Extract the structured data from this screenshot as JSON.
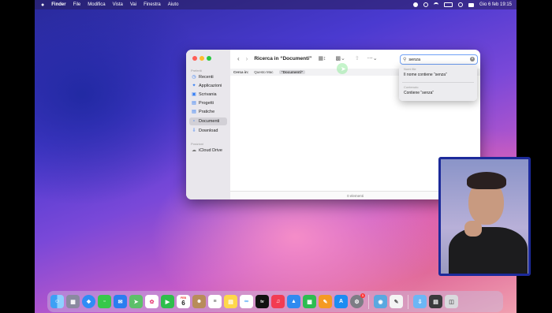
{
  "menubar": {
    "apple_icon": "apple-logo-icon",
    "items": [
      "Finder",
      "File",
      "Modifica",
      "Vista",
      "Vai",
      "Finestra",
      "Aiuto"
    ],
    "datetime": "Gio 6 feb  19:15"
  },
  "finder": {
    "title": "Ricerca in “Documenti”",
    "sidebar": {
      "favorites_header": "Preferiti",
      "items": [
        {
          "label": "Recenti",
          "icon": "clock-icon"
        },
        {
          "label": "Applicazioni",
          "icon": "apps-icon"
        },
        {
          "label": "Scrivania",
          "icon": "desktop-icon"
        },
        {
          "label": "Progetti",
          "icon": "folder-icon"
        },
        {
          "label": "Pratiche",
          "icon": "folder-icon"
        },
        {
          "label": "Documenti",
          "icon": "document-icon",
          "selected": true
        },
        {
          "label": "Download",
          "icon": "download-icon"
        }
      ],
      "locations_header": "Posizioni",
      "locations": [
        {
          "label": "iCloud Drive",
          "icon": "cloud-icon"
        }
      ]
    },
    "search": {
      "value": "senza"
    },
    "scope": {
      "label": "Cerca in:",
      "options": [
        "Questo Mac",
        "“Documenti”"
      ],
      "selected": "“Documenti”"
    },
    "status": "0 elementi"
  },
  "suggestions": {
    "section1_header": "Nomi file",
    "section1_item": "Il nome contiene “senza”",
    "section2_header": "Contenuto",
    "section2_item": "Contiene “senza”"
  },
  "dock": {
    "apps": [
      "Finder",
      "Launchpad",
      "Safari",
      "Messaggi",
      "Mail",
      "Mappe",
      "Foto",
      "FaceTime",
      "Calendario",
      "Contatti",
      "Promemoria",
      "Note",
      "Freeform",
      "TV",
      "Musica",
      "Keynote",
      "Numbers",
      "Pages",
      "App Store",
      "Impostazioni di Sistema",
      "Anteprima",
      "TextEdit",
      "Download",
      "Cartella",
      "Cestino"
    ],
    "calendar_month": "FEB",
    "calendar_day": "6",
    "settings_badge": "1"
  }
}
